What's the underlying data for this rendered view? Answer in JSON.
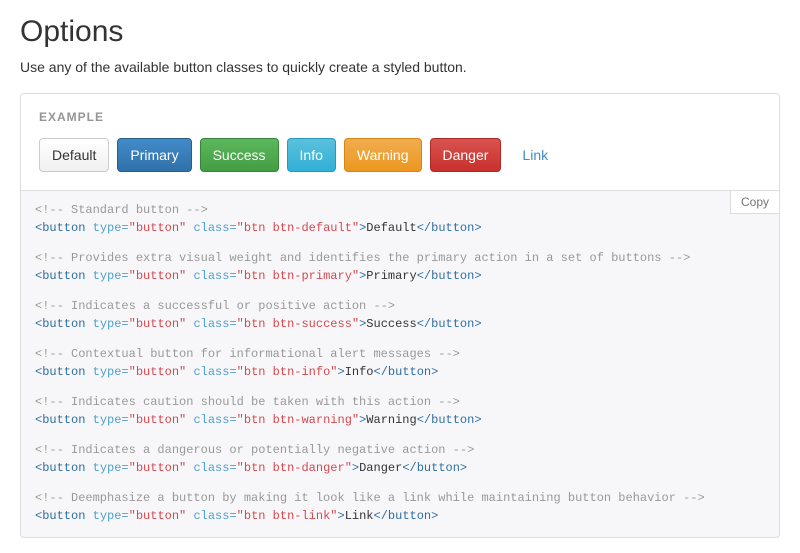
{
  "heading": "Options",
  "lead": "Use any of the available button classes to quickly create a styled button.",
  "example_label": "EXAMPLE",
  "copy_label": "Copy",
  "buttons": {
    "default": "Default",
    "primary": "Primary",
    "success": "Success",
    "info": "Info",
    "warning": "Warning",
    "danger": "Danger",
    "link": "Link"
  },
  "code": [
    {
      "comment": "<!-- Standard button -->",
      "class": "btn btn-default",
      "text": "Default"
    },
    {
      "comment": "<!-- Provides extra visual weight and identifies the primary action in a set of buttons -->",
      "class": "btn btn-primary",
      "text": "Primary"
    },
    {
      "comment": "<!-- Indicates a successful or positive action -->",
      "class": "btn btn-success",
      "text": "Success"
    },
    {
      "comment": "<!-- Contextual button for informational alert messages -->",
      "class": "btn btn-info",
      "text": "Info"
    },
    {
      "comment": "<!-- Indicates caution should be taken with this action -->",
      "class": "btn btn-warning",
      "text": "Warning"
    },
    {
      "comment": "<!-- Indicates a dangerous or potentially negative action -->",
      "class": "btn btn-danger",
      "text": "Danger"
    },
    {
      "comment": "<!-- Deemphasize a button by making it look like a link while maintaining button behavior -->",
      "class": "btn btn-link",
      "text": "Link"
    }
  ],
  "code_common": {
    "tag": "button",
    "type_attr": "type",
    "type_val": "button",
    "class_attr": "class"
  }
}
